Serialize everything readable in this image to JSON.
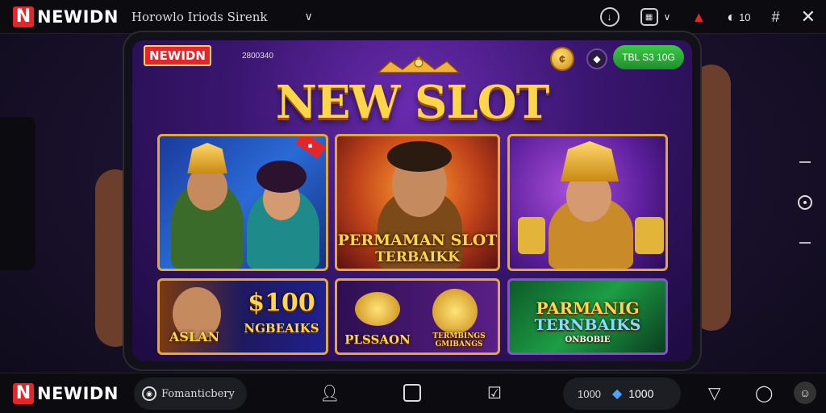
{
  "topbar": {
    "brand": "NEWIDN",
    "search_text": "Horowlo Iriods Sirenk",
    "chevron": "∨",
    "notif_count": "10"
  },
  "tablet": {
    "logo": "NEWIDN",
    "small_text": "2800340",
    "gem_label": "◆",
    "green_button": "TBL S3 10G",
    "title": "NEW SLOT",
    "cards": {
      "c2_title": "PERMAMAN SLOT",
      "c2_sub": "TERBAIKK",
      "c4_left": "ASLAN",
      "c4_amount": "$100",
      "c4_sub": "NGBEAIKS",
      "c5_left": "PLSSAON",
      "c5_right": "TERMBINGS GMIBANGS",
      "c6_title": "PARMANIG",
      "c6_sub": "TERNBAIKS",
      "c6_foot": "ONBOBIE"
    }
  },
  "bottombar": {
    "brand": "NEWIDN",
    "pill_text": "Fomanticbery",
    "balance_left": "1000",
    "balance_right": "1000"
  },
  "colors": {
    "brand_red": "#e3262b",
    "gold": "#ffd54a",
    "green": "#2aa83a"
  }
}
